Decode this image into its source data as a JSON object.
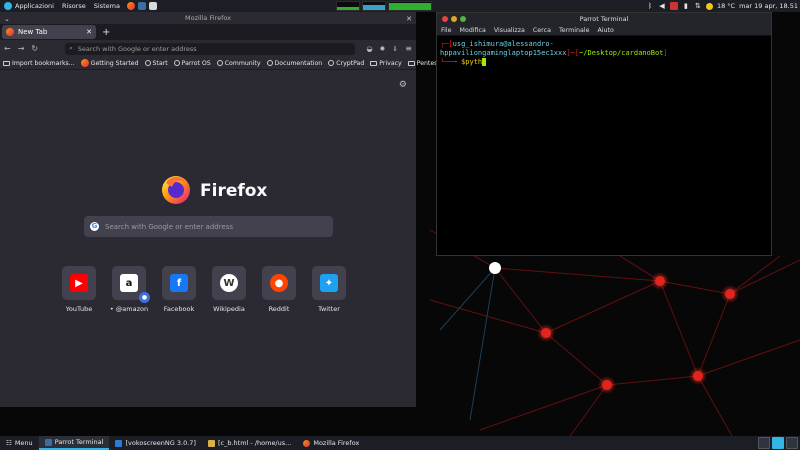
{
  "top_panel": {
    "menus": [
      "Applicazioni",
      "Risorse",
      "Sistema"
    ],
    "weather": "18 °C",
    "clock": "mar 19 apr, 18.51"
  },
  "firefox": {
    "window_title": "Mozilla Firefox",
    "tab_label": "New Tab",
    "url_placeholder": "Search with Google or enter address",
    "bookmarks": [
      "Import bookmarks...",
      "Getting Started",
      "Start",
      "Parrot OS",
      "Community",
      "Documentation",
      "CryptPad",
      "Privacy",
      "Pentest"
    ],
    "brand": "Firefox",
    "search_placeholder": "Search with Google or enter address",
    "top_sites": [
      {
        "label": "YouTube",
        "icon": "youtube-icon",
        "color": "#ff0000"
      },
      {
        "label": "@amazon",
        "icon": "amazon-icon",
        "color": "#ffffff"
      },
      {
        "label": "Facebook",
        "icon": "facebook-icon",
        "color": "#1877f2"
      },
      {
        "label": "Wikipedia",
        "icon": "wikipedia-icon",
        "color": "#ffffff"
      },
      {
        "label": "Reddit",
        "icon": "reddit-icon",
        "color": "#ff4500"
      },
      {
        "label": "Twitter",
        "icon": "twitter-icon",
        "color": "#1da1f2"
      }
    ]
  },
  "terminal": {
    "window_title": "Parrot Terminal",
    "menu": [
      "File",
      "Modifica",
      "Visualizza",
      "Cerca",
      "Terminale",
      "Aiuto"
    ],
    "prompt_user": "usg_ishimura@alessandro-hppaviliongaminglaptop15ec1xxx",
    "prompt_path": "~/Desktop/cardanoBot",
    "command": "$pyth"
  },
  "taskbar": {
    "menu_label": "Menu",
    "items": [
      "Parrot Terminal",
      "[vokoscreenNG 3.0.7]",
      "[c_b.html - /home/us...",
      "Mozilla Firefox"
    ]
  },
  "colors": {
    "accent": "#33b5e5",
    "wallpaper_node": "#e2241f"
  }
}
